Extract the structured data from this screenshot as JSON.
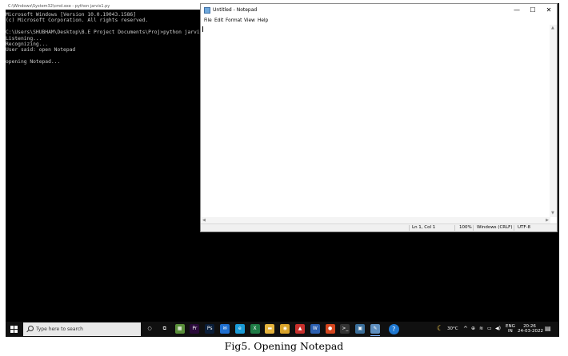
{
  "cmd": {
    "title": "C:\\Windows\\System32\\cmd.exe - python jarvis1.py",
    "lines": [
      "Microsoft Windows [Version 10.0.19043.1586]",
      "(c) Microsoft Corporation. All rights reserved.",
      "",
      "C:\\Users\\SHUBHAM\\Desktop\\B.E Project Documents\\Proj>python jarvis1.py",
      "Listening...",
      "Recognizing...",
      "User said: open Notepad",
      "",
      "opening Notepad..."
    ]
  },
  "notepad": {
    "title": "Untitled - Notepad",
    "controls": {
      "minimize": "—",
      "maximize": "☐",
      "close": "✕"
    },
    "menu": [
      "File",
      "Edit",
      "Format",
      "View",
      "Help"
    ],
    "status": {
      "position": "Ln 1, Col 1",
      "zoom": "100%",
      "line_ending": "Windows (CRLF)",
      "encoding": "UTF-8"
    }
  },
  "taskbar": {
    "search_placeholder": "Type here to search",
    "apps": [
      {
        "icon": "cortana-icon",
        "glyph": "○",
        "color": "#101010"
      },
      {
        "icon": "task-view-icon",
        "glyph": "⧉",
        "color": "#101010"
      },
      {
        "icon": "minecraft-icon",
        "glyph": "▦",
        "color": "#5a8f3a"
      },
      {
        "icon": "premiere-pro-icon",
        "glyph": "Pr",
        "color": "#2a0a3a"
      },
      {
        "icon": "photoshop-icon",
        "glyph": "Ps",
        "color": "#0a1e3a"
      },
      {
        "icon": "mail-icon",
        "glyph": "✉",
        "color": "#1f6fd0"
      },
      {
        "icon": "edge-icon",
        "glyph": "e",
        "color": "#1a9bd7"
      },
      {
        "icon": "excel-icon",
        "glyph": "X",
        "color": "#1e7b45"
      },
      {
        "icon": "file-explorer-icon",
        "glyph": "▬",
        "color": "#e5b33c"
      },
      {
        "icon": "chrome-icon",
        "glyph": "◉",
        "color": "#d9a32a"
      },
      {
        "icon": "pdf-reader-icon",
        "glyph": "▲",
        "color": "#c9302c"
      },
      {
        "icon": "word-icon",
        "glyph": "W",
        "color": "#2b5fb0"
      },
      {
        "icon": "media-player-icon",
        "glyph": "●",
        "color": "#d5461e"
      },
      {
        "icon": "terminal-icon",
        "glyph": ">_",
        "color": "#333333"
      },
      {
        "icon": "image-viewer-icon",
        "glyph": "▣",
        "color": "#3a6e9a"
      },
      {
        "icon": "notepad-icon",
        "glyph": "✎",
        "color": "#5f8fbf"
      },
      {
        "icon": "help-icon",
        "glyph": "?",
        "color": "#1f78d1"
      }
    ],
    "weather": "30°C",
    "language": {
      "line1": "ENG",
      "line2": "IN"
    },
    "time": "20:26",
    "date": "24-03-2022"
  },
  "caption": "Fig5. Opening Notepad"
}
